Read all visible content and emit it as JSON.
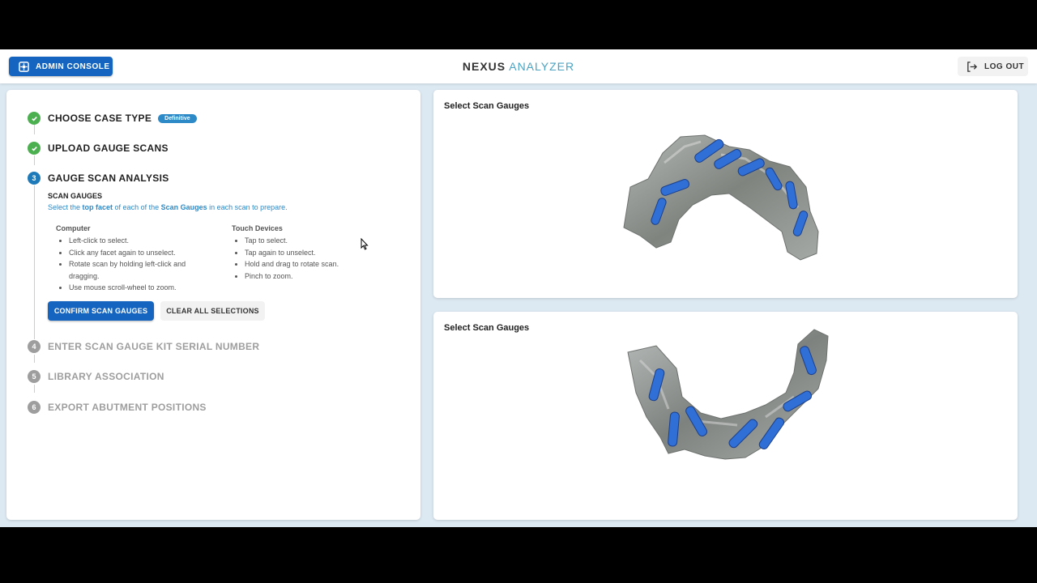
{
  "header": {
    "admin_label": "ADMIN CONSOLE",
    "brand_primary": "NEXUS",
    "brand_secondary": "ANALYZER",
    "logout_label": "LOG OUT"
  },
  "steps": [
    {
      "number": "1",
      "title": "CHOOSE CASE TYPE",
      "status": "complete",
      "badge": "Definitive"
    },
    {
      "number": "2",
      "title": "UPLOAD GAUGE SCANS",
      "status": "complete"
    },
    {
      "number": "3",
      "title": "GAUGE SCAN ANALYSIS",
      "status": "active"
    },
    {
      "number": "4",
      "title": "ENTER SCAN GAUGE KIT SERIAL NUMBER",
      "status": "pending"
    },
    {
      "number": "5",
      "title": "LIBRARY ASSOCIATION",
      "status": "pending"
    },
    {
      "number": "6",
      "title": "EXPORT ABUTMENT POSITIONS",
      "status": "pending"
    }
  ],
  "active_step": {
    "subtitle": "SCAN GAUGES",
    "desc_part1": "Select the ",
    "desc_bold1": "top facet",
    "desc_part2": " of each of the ",
    "desc_bold2": "Scan Gauges",
    "desc_part3": " in each scan to prepare.",
    "computer": {
      "heading": "Computer",
      "items": [
        "Left-click to select.",
        "Click any facet again to unselect.",
        "Rotate scan by holding left-click and dragging.",
        "Use mouse scroll-wheel to zoom."
      ]
    },
    "touch": {
      "heading": "Touch Devices",
      "items": [
        "Tap to select.",
        "Tap again to unselect.",
        "Hold and drag to rotate scan.",
        "Pinch to zoom."
      ]
    },
    "confirm_label": "CONFIRM SCAN GAUGES",
    "clear_label": "CLEAR ALL SELECTIONS"
  },
  "viewers": [
    {
      "title": "Select Scan Gauges"
    },
    {
      "title": "Select Scan Gauges"
    }
  ],
  "colors": {
    "primary": "#1565c0",
    "complete": "#4caf50",
    "active": "#1e7ab8",
    "pending": "#9e9e9e",
    "brand_accent": "#4aa3c3",
    "gauge_blue": "#2f6fd6",
    "scan_gray": "#8e9290"
  },
  "icons": {
    "admin": "admin-panel-icon",
    "logout": "logout-icon",
    "step_complete": "check-circle-icon",
    "cursor": "mouse-pointer-icon"
  }
}
